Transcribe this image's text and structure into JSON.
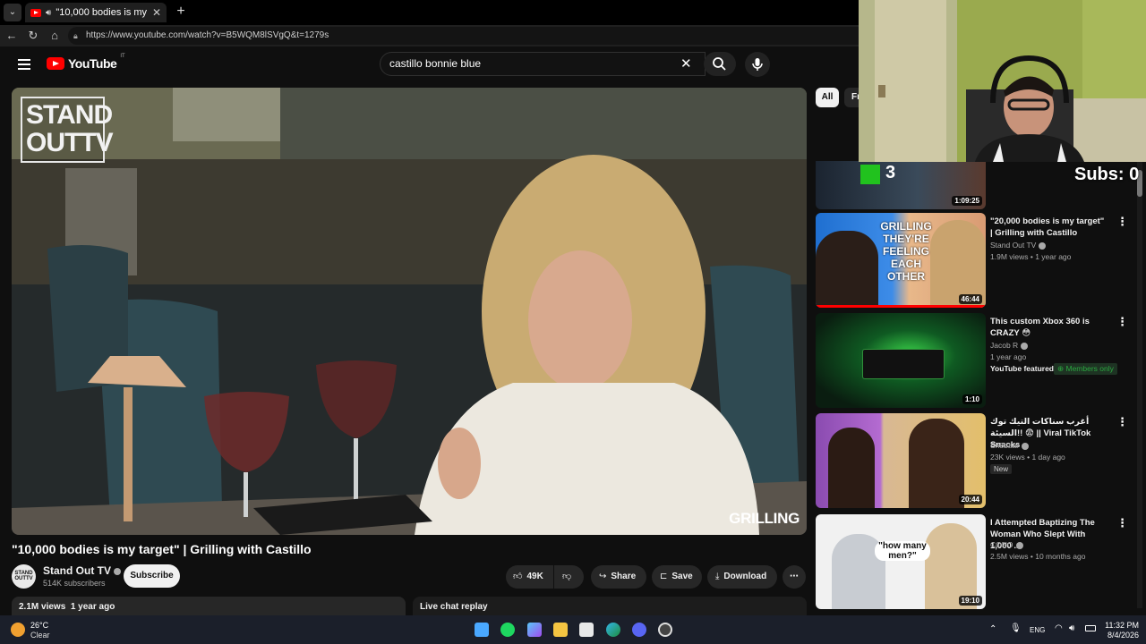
{
  "browser": {
    "tab_title": "\"10,000 bodies is my target\" | Grilling with Castillo",
    "url": "https://www.youtube.com/watch?v=B5WQM8lSVgQ&t=1279s"
  },
  "youtube": {
    "logo_text": "YouTube",
    "logo_country": "IT",
    "search_query": "castillo bonnie blue"
  },
  "video": {
    "overlay_logo": "STAND OUT TV",
    "overlay_logo_line1": "STAND",
    "overlay_logo_line2": "OUTTV",
    "overlay_tag": "GRILLING",
    "title": "\"10,000 bodies is my target\" | Grilling with Castillo",
    "channel_name": "Stand Out TV",
    "channel_subs": "514K subscribers",
    "avatar_text": "STAND OUTTV",
    "subscribe_label": "Subscribe",
    "likes": "49K",
    "share_label": "Share",
    "save_label": "Save",
    "download_label": "Download",
    "views": "2.1M views",
    "age": "1 year ago",
    "chat_label": "Live chat replay"
  },
  "sidebar": {
    "chips": [
      "All",
      "Fr"
    ],
    "recommendations": [
      {
        "title": "",
        "channel": "",
        "meta": "",
        "duration": "1:09:25",
        "thumb_text": "3"
      },
      {
        "title": "\"20,000 bodies is my target\" | Grilling with Castillo",
        "channel": "Stand Out TV",
        "meta": "1.9M views • 1 year ago",
        "duration": "46:44",
        "thumb_text": "GRILLING THEY'RE FEELING EACH OTHER"
      },
      {
        "title": "This custom Xbox 360 is CRAZY 😳",
        "channel": "Jacob R",
        "meta": "1 year ago",
        "extra": "YouTube featured",
        "members": "Members only",
        "duration": "1:10"
      },
      {
        "title": "أغرب سناكات التيك توك السيئة!! 😨 || Viral TikTok Snacks",
        "channel": "Sh5baar",
        "meta": "23K views • 1 day ago",
        "badge": "New",
        "duration": "20:44"
      },
      {
        "title": "I Attempted Baptizing The Woman Who Slept With 1,000 ...",
        "channel": "CONO",
        "meta": "2.5M views • 10 months ago",
        "duration": "19:10",
        "thumb_text": "\"how many men?\""
      }
    ]
  },
  "stream": {
    "subs_counter": "Subs: 0"
  },
  "taskbar": {
    "temperature": "26°C",
    "weather": "Clear",
    "language": "ENG",
    "time": "11:32 PM",
    "date": "8/4/2026"
  }
}
